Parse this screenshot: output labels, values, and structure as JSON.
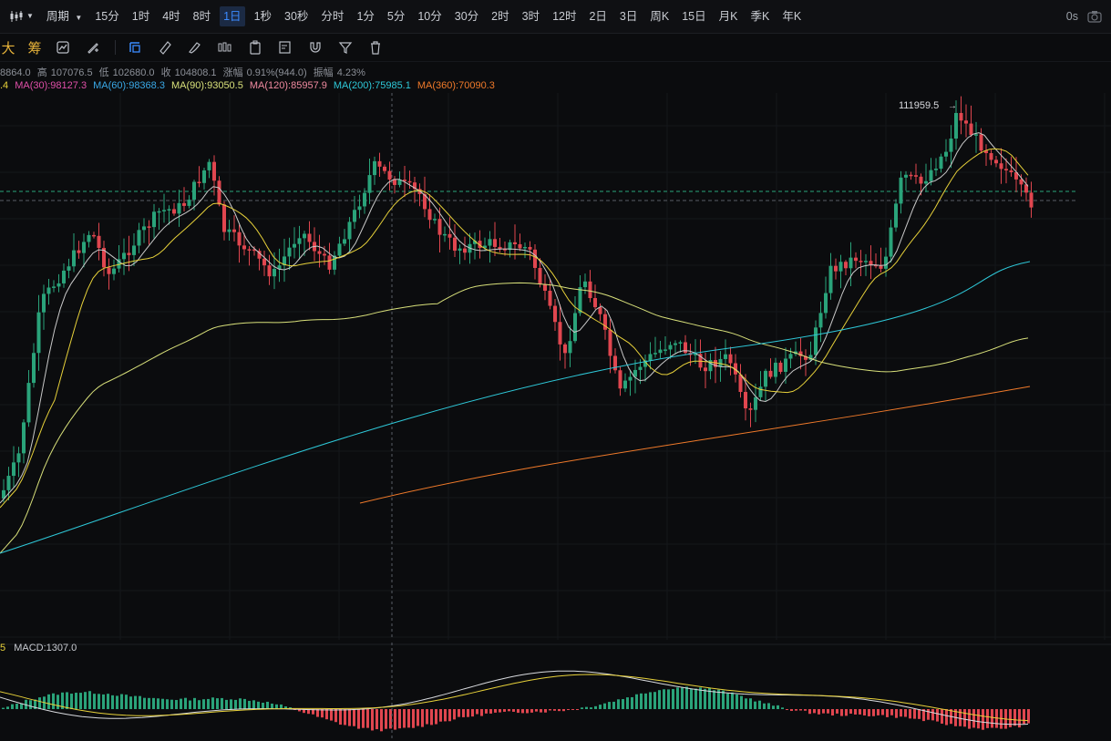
{
  "topbar": {
    "chart_type_icon": "candlestick-icon",
    "period_label": "周期",
    "timeframes": [
      "15分",
      "1时",
      "4时",
      "8时",
      "1日",
      "1秒",
      "30秒",
      "分时",
      "1分",
      "5分",
      "10分",
      "30分",
      "2时",
      "3时",
      "12时",
      "2日",
      "3日",
      "周K",
      "15日",
      "月K",
      "季K",
      "年K"
    ],
    "active_timeframe": "1日",
    "latency": "0s",
    "screenshot_icon": "camera-icon"
  },
  "toolbar": {
    "labels": [
      "大",
      "筹"
    ],
    "icons": [
      "indicator-icon",
      "pencil-cross-icon",
      "rectangle-select-icon",
      "ruler-icon",
      "brush-icon",
      "candle-pattern-icon",
      "clipboard-icon",
      "note-edit-icon",
      "magnet-icon",
      "filter-icon",
      "trash-icon"
    ]
  },
  "ohlc": {
    "open": "8864.0",
    "high_label": "高",
    "high": "107076.5",
    "low_label": "低",
    "low": "102680.0",
    "close_label": "收",
    "close": "104808.1",
    "change_label": "涨幅",
    "change": "0.91%(944.0)",
    "amplitude_label": "振幅",
    "amplitude": "4.23%"
  },
  "ma_legend": [
    {
      "text": ".4",
      "color": "#e7d13a"
    },
    {
      "text": "MA(30):98127.3",
      "color": "#e04fa8"
    },
    {
      "text": "MA(60):98368.3",
      "color": "#3aa8e6"
    },
    {
      "text": "MA(90):93050.5",
      "color": "#d8e07a"
    },
    {
      "text": "MA(120):85957.9",
      "color": "#f08aa0"
    },
    {
      "text": "MA(200):75985.1",
      "color": "#2ec8d8"
    },
    {
      "text": "MA(360):70090.3",
      "color": "#f07a2a"
    }
  ],
  "price_annotation": "111959.5",
  "macd": {
    "legend_prefix": "5",
    "legend": "MACD:1307.0"
  },
  "colors": {
    "up": "#2aa37a",
    "down": "#e0464f",
    "bg": "#0b0c0e",
    "accent": "#3b8bff"
  }
}
